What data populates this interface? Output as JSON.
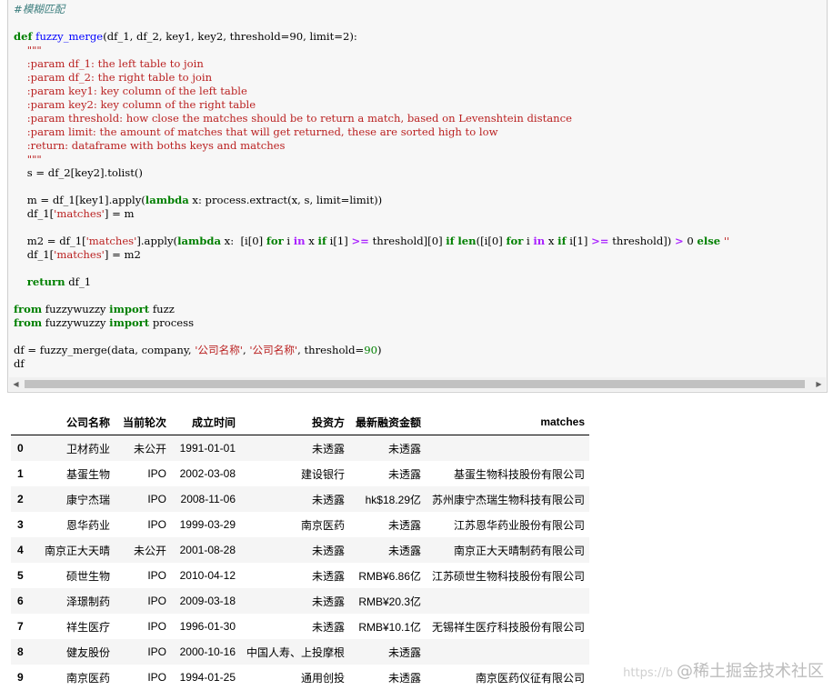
{
  "code": {
    "comment": "#模糊匹配",
    "def_kw": "def",
    "func_name": "fuzzy_merge",
    "signature_rest": "(df_1, df_2, key1, key2, threshold=90, limit=2):",
    "doc_open": "    \"\"\"",
    "doc_lines": [
      "    :param df_1: the left table to join",
      "    :param df_2: the right table to join",
      "    :param key1: key column of the left table",
      "    :param key2: key column of the right table",
      "    :param threshold: how close the matches should be to return a match, based on Levenshtein distance",
      "    :param limit: the amount of matches that will get returned, these are sorted high to low",
      "    :return: dataframe with boths keys and matches"
    ],
    "doc_close": "    \"\"\"",
    "line_s": "    s = df_2[key2].tolist()",
    "line_m_pre": "    m = df_1[key1].apply(",
    "line_m_lambda": "lambda",
    "line_m_post": " x: process.extract(x, s, limit=limit))",
    "line_assign1_pre": "    df_1[",
    "line_assign1_str": "'matches'",
    "line_assign1_post": "] = m",
    "line_m2": {
      "p1": "    m2 = df_1[",
      "s1": "'matches'",
      "p2": "].apply(",
      "kw_lambda": "lambda",
      "p3": " x:  [i[0] ",
      "kw_for": "for",
      "p4": " i ",
      "kw_in": "in",
      "p5": " x ",
      "kw_if": "if",
      "p6": " i[1] ",
      "op_ge": ">=",
      "p7": " threshold][0] ",
      "kw_if2": "if",
      "p8": " ",
      "fn_len": "len",
      "p9": "([i[0] ",
      "kw_for2": "for",
      "p10": " i ",
      "kw_in2": "in",
      "p11": " x ",
      "kw_if3": "if",
      "p12": " i[1] ",
      "op_ge2": ">=",
      "p13": " threshold]) ",
      "op_gt": ">",
      "p14": " 0 ",
      "kw_else": "else",
      "s2": " ''"
    },
    "line_assign2_pre": "    df_1[",
    "line_assign2_str": "'matches'",
    "line_assign2_post": "] = m2",
    "return_kw": "return",
    "return_rest": " df_1",
    "from_kw": "from",
    "import_kw": "import",
    "import1_mod": " fuzzywuzzy ",
    "import1_name": " fuzz",
    "import2_mod": " fuzzywuzzy ",
    "import2_name": " process",
    "call_pre": "df = fuzzy_merge(data, company, ",
    "call_str1": "'公司名称'",
    "call_sep": ", ",
    "call_str2": "'公司名称'",
    "call_post": ", threshold=",
    "call_num": "90",
    "call_close": ")",
    "last_line": "df"
  },
  "table": {
    "headers": [
      "",
      "公司名称",
      "当前轮次",
      "成立时间",
      "投资方",
      "最新融资金额",
      "matches"
    ],
    "rows": [
      [
        "0",
        "卫材药业",
        "未公开",
        "1991-01-01",
        "未透露",
        "未透露",
        ""
      ],
      [
        "1",
        "基蛋生物",
        "IPO",
        "2002-03-08",
        "建设银行",
        "未透露",
        "基蛋生物科技股份有限公司"
      ],
      [
        "2",
        "康宁杰瑞",
        "IPO",
        "2008-11-06",
        "未透露",
        "hk$18.29亿",
        "苏州康宁杰瑞生物科技有限公司"
      ],
      [
        "3",
        "恩华药业",
        "IPO",
        "1999-03-29",
        "南京医药",
        "未透露",
        "江苏恩华药业股份有限公司"
      ],
      [
        "4",
        "南京正大天晴",
        "未公开",
        "2001-08-28",
        "未透露",
        "未透露",
        "南京正大天晴制药有限公司"
      ],
      [
        "5",
        "硕世生物",
        "IPO",
        "2010-04-12",
        "未透露",
        "RMB¥6.86亿",
        "江苏硕世生物科技股份有限公司"
      ],
      [
        "6",
        "泽璟制药",
        "IPO",
        "2009-03-18",
        "未透露",
        "RMB¥20.3亿",
        ""
      ],
      [
        "7",
        "祥生医疗",
        "IPO",
        "1996-01-30",
        "未透露",
        "RMB¥10.1亿",
        "无锡祥生医疗科技股份有限公司"
      ],
      [
        "8",
        "健友股份",
        "IPO",
        "2000-10-16",
        "中国人寿、上投摩根",
        "未透露",
        ""
      ],
      [
        "9",
        "南京医药",
        "IPO",
        "1994-01-25",
        "通用创投",
        "未透露",
        "南京医药仪征有限公司"
      ]
    ]
  },
  "watermark": {
    "url": "https://b",
    "text": "@稀土掘金技术社区"
  }
}
